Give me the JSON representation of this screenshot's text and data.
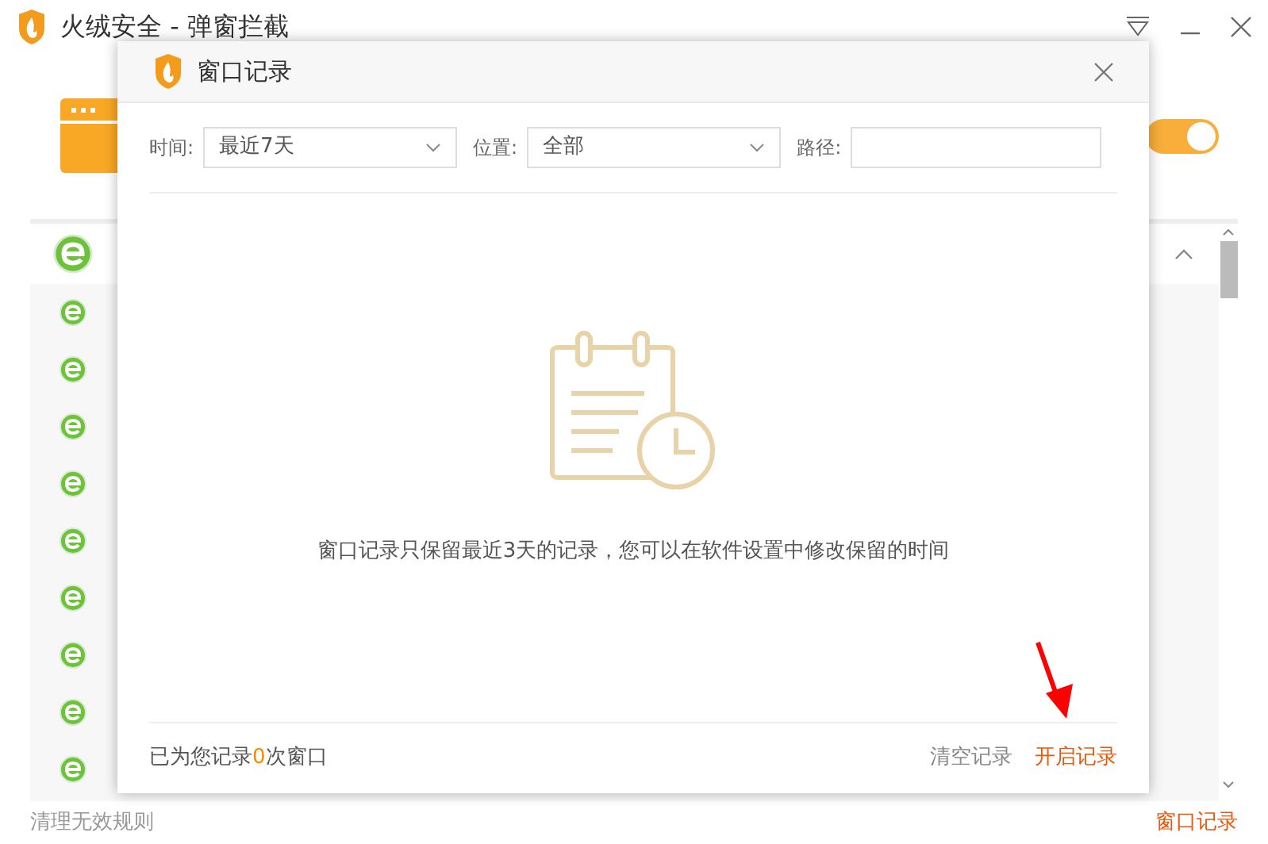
{
  "window": {
    "title": "火绒安全 - 弹窗拦截"
  },
  "background_list": {
    "expanded": true
  },
  "toggle": {
    "on": true
  },
  "bottom_bar": {
    "left_link": "清理无效规则",
    "right_link": "窗口记录"
  },
  "dialog": {
    "title": "窗口记录",
    "filters": [
      {
        "kind": "select",
        "label": "时间:",
        "value": "最近7天"
      },
      {
        "kind": "select",
        "label": "位置:",
        "value": "全部"
      },
      {
        "kind": "input",
        "label": "路径:"
      }
    ],
    "empty_message": "窗口记录只保留最近3天的记录，您可以在软件设置中修改保留的时间",
    "footer": {
      "count_prefix": "已为您记录",
      "count": "0",
      "count_suffix": "次窗口",
      "buttons": [
        {
          "label": "清空记录",
          "kind": "secondary"
        },
        {
          "label": "开启记录",
          "kind": "primary"
        }
      ]
    }
  }
}
